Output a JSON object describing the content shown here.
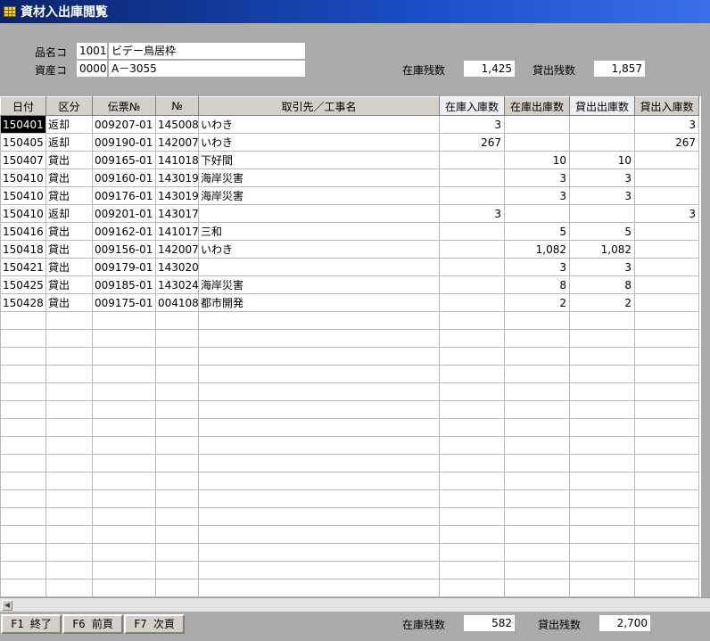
{
  "window": {
    "title": "資材入出庫閲覧",
    "icon": "table-icon"
  },
  "header": {
    "item_label": "品名コ",
    "item_code": "1001",
    "item_name": "ビデー鳥居枠",
    "asset_label": "資産コ",
    "asset_code": "0000",
    "asset_name": "A－3055",
    "stock_label": "在庫残数",
    "stock_value": "1,425",
    "loan_label": "貸出残数",
    "loan_value": "1,857"
  },
  "table": {
    "columns": [
      "日付",
      "区分",
      "伝票№",
      "№",
      "取引先／工事名",
      "在庫入庫数",
      "在庫出庫数",
      "貸出出庫数",
      "貸出入庫数"
    ],
    "rows": [
      [
        "150401",
        "返却",
        "009207-01",
        "145008",
        "いわき",
        "3",
        "",
        "",
        "3"
      ],
      [
        "150405",
        "返却",
        "009190-01",
        "142007",
        "いわき",
        "267",
        "",
        "",
        "267"
      ],
      [
        "150407",
        "貸出",
        "009165-01",
        "141018",
        "下好間",
        "",
        "10",
        "10",
        ""
      ],
      [
        "150410",
        "貸出",
        "009160-01",
        "143019",
        "海岸災害",
        "",
        "3",
        "3",
        ""
      ],
      [
        "150410",
        "貸出",
        "009176-01",
        "143019",
        "海岸災害",
        "",
        "3",
        "3",
        ""
      ],
      [
        "150410",
        "返却",
        "009201-01",
        "143017",
        "",
        "3",
        "",
        "",
        "3"
      ],
      [
        "150416",
        "貸出",
        "009162-01",
        "141017",
        "三和",
        "",
        "5",
        "5",
        ""
      ],
      [
        "150418",
        "貸出",
        "009156-01",
        "142007",
        "いわき",
        "",
        "1,082",
        "1,082",
        ""
      ],
      [
        "150421",
        "貸出",
        "009179-01",
        "143020",
        "",
        "",
        "3",
        "3",
        ""
      ],
      [
        "150425",
        "貸出",
        "009185-01",
        "143024",
        "海岸災害",
        "",
        "8",
        "8",
        ""
      ],
      [
        "150428",
        "貸出",
        "009175-01",
        "004108",
        "都市開発",
        "",
        "2",
        "2",
        ""
      ]
    ],
    "empty_rows": 16
  },
  "footer": {
    "f1_label": "F1 終了",
    "f6_label": "F6 前頁",
    "f7_label": "F7 次頁",
    "stock_label": "在庫残数",
    "stock_value": "582",
    "loan_label": "貸出残数",
    "loan_value": "2,700"
  }
}
